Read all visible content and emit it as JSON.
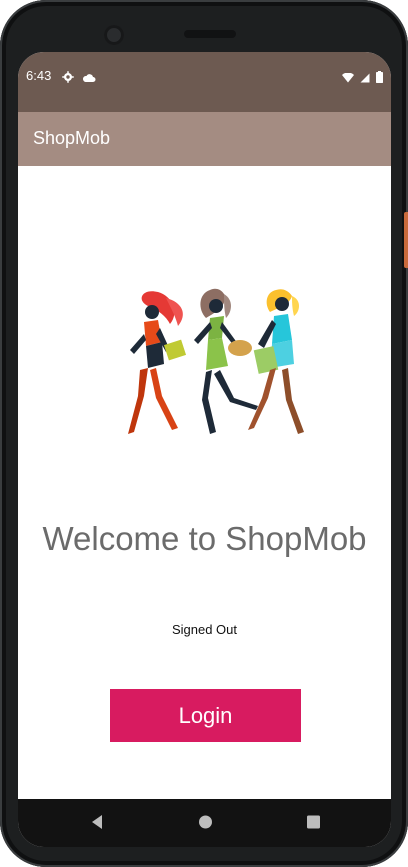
{
  "status_bar": {
    "time": "6:43",
    "left_icons": [
      "settings-icon",
      "cloud-icon"
    ],
    "right_icons": [
      "wifi-icon",
      "signal-icon",
      "battery-icon"
    ]
  },
  "app_bar": {
    "title": "ShopMob"
  },
  "hero": {
    "image_name": "shopping-women-illustration"
  },
  "main": {
    "welcome_text": "Welcome to ShopMob",
    "status_text": "Signed Out",
    "login_label": "Login"
  },
  "nav_bar": {
    "buttons": [
      "back-button",
      "home-button",
      "recents-button"
    ]
  },
  "colors": {
    "status_bar": "#6d5a51",
    "app_bar": "#a48c82",
    "accent": "#d81b60",
    "welcome_text": "#6b6b6b"
  }
}
